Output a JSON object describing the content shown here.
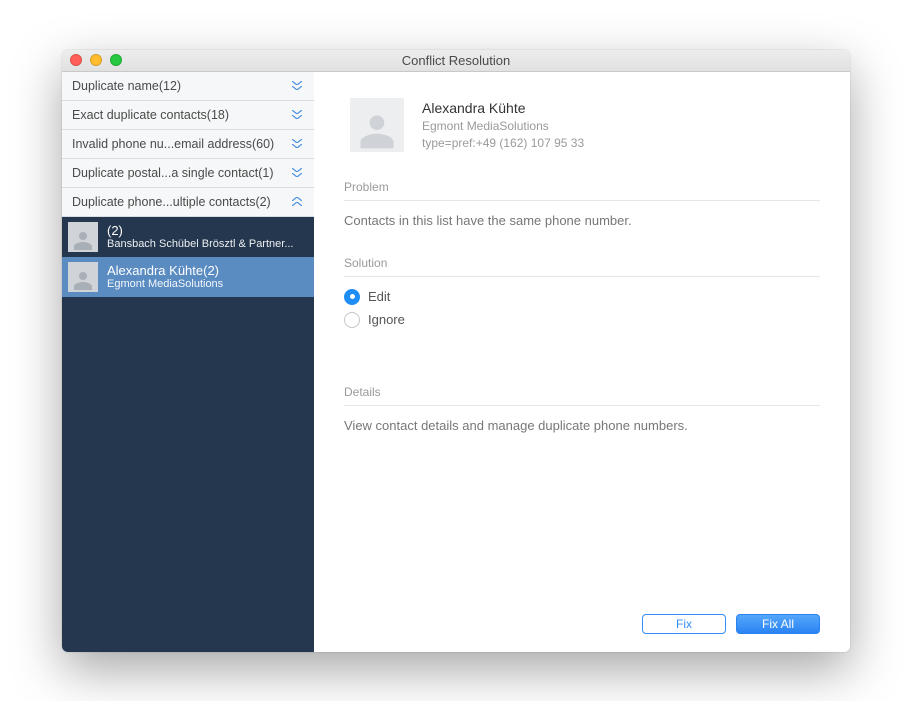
{
  "window": {
    "title": "Conflict Resolution"
  },
  "sidebar": {
    "categories": [
      {
        "label": "Duplicate name(12)"
      },
      {
        "label": "Exact duplicate contacts(18)"
      },
      {
        "label": "Invalid phone nu...email address(60)"
      },
      {
        "label": "Duplicate postal...a single contact(1)"
      },
      {
        "label": "Duplicate phone...ultiple contacts(2)"
      }
    ],
    "contacts": [
      {
        "title": " (2)",
        "subtitle": "Bansbach Schübel Brösztl & Partner..."
      },
      {
        "title": "Alexandra Kühte(2)",
        "subtitle": "Egmont MediaSolutions"
      }
    ]
  },
  "detail": {
    "name": "Alexandra Kühte",
    "org": "Egmont MediaSolutions",
    "phone": "type=pref:+49 (162) 107 95 33",
    "problem_header": "Problem",
    "problem_text": "Contacts in this list have the same phone number.",
    "solution_header": "Solution",
    "solution_options": {
      "edit": "Edit",
      "ignore": "Ignore"
    },
    "details_header": "Details",
    "details_text": "View contact details and manage duplicate phone numbers."
  },
  "buttons": {
    "fix": "Fix",
    "fix_all": "Fix All"
  }
}
